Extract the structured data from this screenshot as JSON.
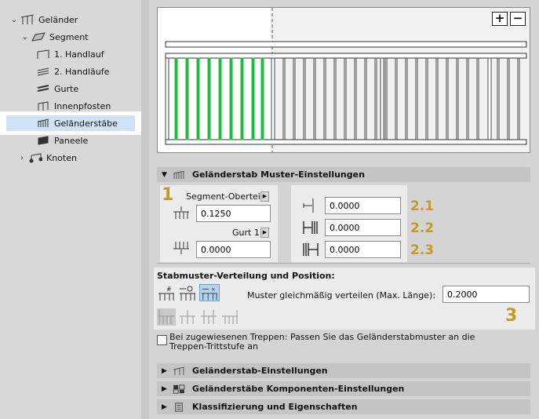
{
  "tree": {
    "items": [
      {
        "label": "Geländer",
        "level": 0,
        "expanded": true
      },
      {
        "label": "Segment",
        "level": 1,
        "expanded": true
      },
      {
        "label": "1. Handlauf",
        "level": 2
      },
      {
        "label": "2. Handläufe",
        "level": 2
      },
      {
        "label": "Gurte",
        "level": 2
      },
      {
        "label": "Innenpfosten",
        "level": 2
      },
      {
        "label": "Geländerstäbe",
        "level": 2,
        "selected": true
      },
      {
        "label": "Paneele",
        "level": 2
      },
      {
        "label": "Knoten",
        "level": 1,
        "expanded": false
      }
    ]
  },
  "preview": {
    "zoom_in": "+",
    "zoom_out": "−"
  },
  "sections": {
    "pattern_settings": "Geländerstab Muster-Einstellungen",
    "baluster_settings": "Geländerstab-Einstellungen",
    "component_settings": "Geländerstäbe Komponenten-Einstellungen",
    "classification": "Klassifizierung und Eigenschaften"
  },
  "pattern": {
    "group1_marker": "1",
    "top_ref_label": "Segment-Oberteil",
    "top_offset": "0.1250",
    "bottom_ref_label": "Gurt 1",
    "bottom_offset": "0.0000",
    "group2_markers": [
      "2.1",
      "2.2",
      "2.3"
    ],
    "offsets": [
      "0.0000",
      "0.0000",
      "0.0000"
    ]
  },
  "distribution": {
    "heading": "Stabmuster-Verteilung und Position:",
    "even_label": "Muster gleichmäßig verteilen (Max. Länge):",
    "max_length": "0.2000",
    "marker": "3"
  },
  "stairs_option": {
    "checked": false,
    "label_line1": "Bei zugewiesenen Treppen: Passen Sie das Geländerstabmuster an die",
    "label_line2": "Treppen-Trittstufe an"
  },
  "colors": {
    "accent_number": "#c49a2a",
    "selection": "#cfe2f6",
    "green_baluster": "#22bb44"
  }
}
